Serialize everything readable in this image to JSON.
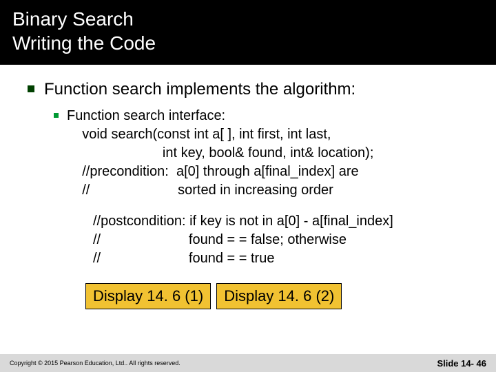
{
  "title": {
    "line1": "Binary Search",
    "line2": "Writing the Code"
  },
  "main_bullet": "Function search implements the algorithm:",
  "sub_bullet": "Function search interface:\n    void search(const int a[ ], int first, int last,\n                         int key, bool& found, int& location);\n    //precondition:  a[0] through a[final_index] are \n    //                       sorted in increasing order",
  "post_text": "//postcondition: if key is not in a[0] - a[final_index]\n//                       found = = false; otherwise\n//                       found = = true",
  "display_buttons": [
    "Display 14. 6 (1)",
    "Display 14. 6 (2)"
  ],
  "footer": {
    "copyright": "Copyright © 2015 Pearson Education, Ltd..  All rights reserved.",
    "slide": "Slide 14- 46"
  }
}
